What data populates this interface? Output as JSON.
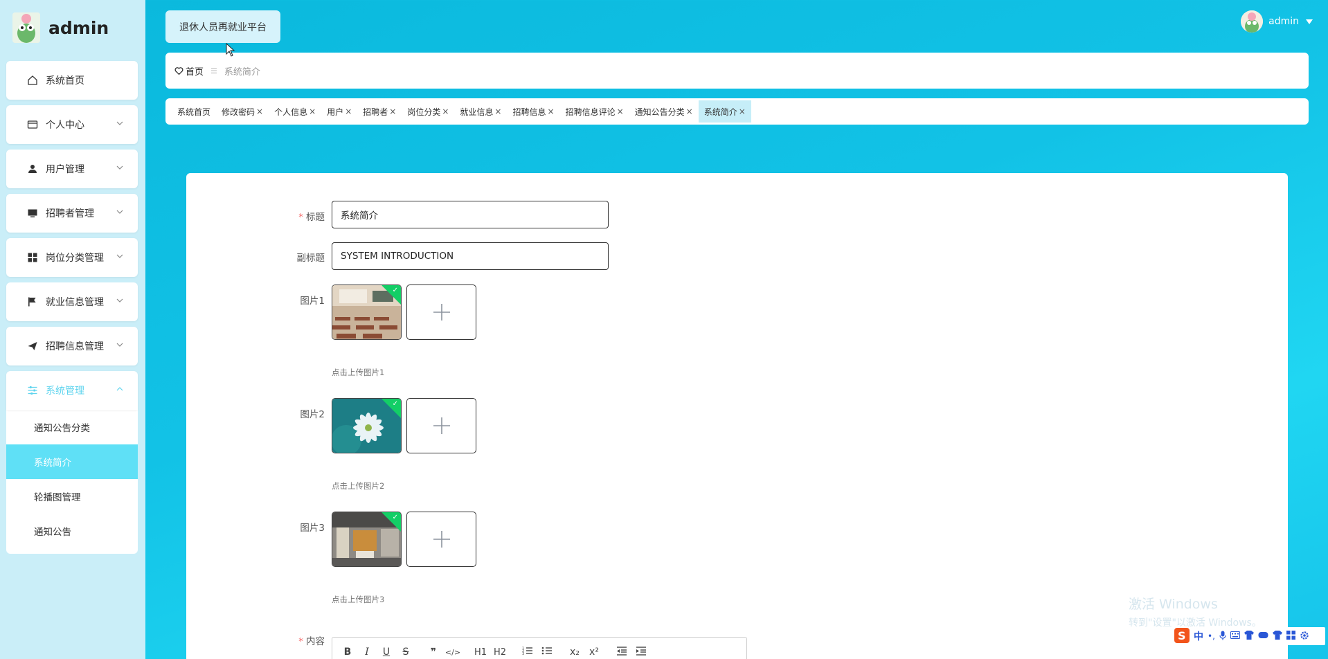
{
  "brand": {
    "title": "admin"
  },
  "sidebar": {
    "items": [
      {
        "label": "系统首页",
        "icon": "home-icon"
      },
      {
        "label": "个人中心",
        "icon": "card-icon"
      },
      {
        "label": "用户管理",
        "icon": "user-icon"
      },
      {
        "label": "招聘者管理",
        "icon": "monitor-icon"
      },
      {
        "label": "岗位分类管理",
        "icon": "grid-icon"
      },
      {
        "label": "就业信息管理",
        "icon": "flag-icon"
      },
      {
        "label": "招聘信息管理",
        "icon": "send-icon"
      },
      {
        "label": "系统管理",
        "icon": "sliders-icon"
      }
    ],
    "submenu": [
      "通知公告分类",
      "系统简介",
      "轮播图管理",
      "通知公告"
    ]
  },
  "header": {
    "site_title": "退休人员再就业平台",
    "username": "admin"
  },
  "breadcrumb": {
    "home": "首页",
    "current": "系统简介"
  },
  "tabs": [
    "系统首页",
    "修改密码",
    "个人信息",
    "用户",
    "招聘者",
    "岗位分类",
    "就业信息",
    "招聘信息",
    "招聘信息评论",
    "通知公告分类",
    "系统简介"
  ],
  "form": {
    "title_label": "标题",
    "title_value": "系统简介",
    "subtitle_label": "副标题",
    "subtitle_value": "SYSTEM INTRODUCTION",
    "pic1_label": "图片1",
    "pic1_tip": "点击上传图片1",
    "pic2_label": "图片2",
    "pic2_tip": "点击上传图片2",
    "pic3_label": "图片3",
    "pic3_tip": "点击上传图片3",
    "content_label": "内容"
  },
  "editor_toolbar": [
    "B",
    "I",
    "U",
    "S",
    "❞",
    "</>",
    "H1",
    "H2",
    "ol",
    "ul",
    "x₂",
    "x²",
    "outdent",
    "indent"
  ],
  "watermark": {
    "line1": "激活 Windows",
    "line2": "转到\"设置\"以激活 Windows。"
  },
  "ime": {
    "label": "中"
  },
  "colors": {
    "accent": "#5fe0f6",
    "required": "#f56c6c",
    "success": "#13ce66"
  }
}
